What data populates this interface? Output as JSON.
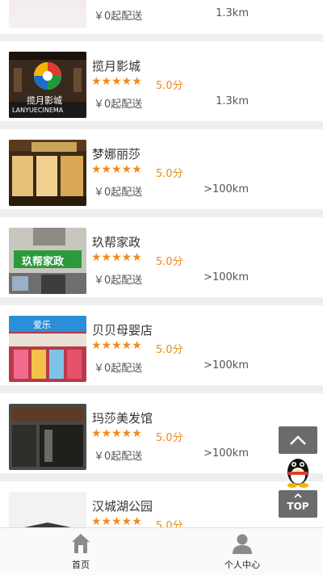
{
  "stores": [
    {
      "name": "",
      "stars": "★★★★★",
      "score": "",
      "min_order": "￥0起配送",
      "distance": "1.3km"
    },
    {
      "name": "揽月影城",
      "stars": "★★★★★",
      "score": "5.0分",
      "min_order": "￥0起配送",
      "distance": "1.3km",
      "thumb_text": "揽月影城",
      "thumb_sub": "LANYUECINEMA"
    },
    {
      "name": "梦娜丽莎",
      "stars": "★★★★★",
      "score": "5.0分",
      "min_order": "￥0起配送",
      "distance": ">100km"
    },
    {
      "name": "玖帮家政",
      "stars": "★★★★★",
      "score": "5.0分",
      "min_order": "￥0起配送",
      "distance": ">100km",
      "thumb_text": "玖帮家政"
    },
    {
      "name": "贝贝母婴店",
      "stars": "★★★★★",
      "score": "5.0分",
      "min_order": "￥0起配送",
      "distance": ">100km",
      "thumb_text": "爱乐"
    },
    {
      "name": "玛莎美发馆",
      "stars": "★★★★★",
      "score": "5.0分",
      "min_order": "￥0起配送",
      "distance": ">100km"
    },
    {
      "name": "汉城湖公园",
      "stars": "★★★★★",
      "score": "5.0分",
      "min_order": "",
      "distance": ""
    }
  ],
  "tabs": [
    {
      "label": "首页",
      "icon": "home-icon"
    },
    {
      "label": "个人中心",
      "icon": "user-icon"
    }
  ],
  "float": {
    "up_icon": "chevron-up-icon",
    "qq_icon": "qq-penguin-icon",
    "top_label": "TOP"
  },
  "colors": {
    "accent": "#f08a1c",
    "float_bg": "#6b6b6b"
  }
}
